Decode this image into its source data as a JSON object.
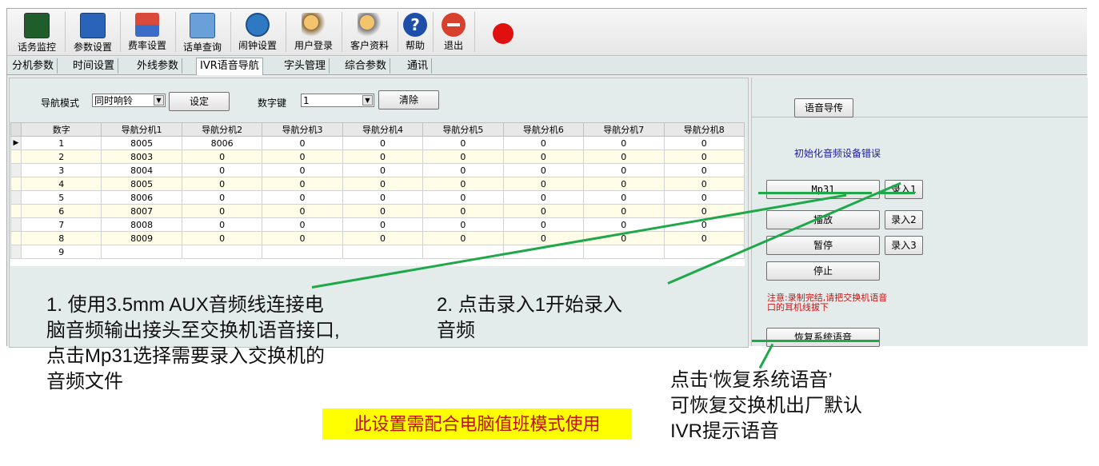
{
  "toolbar": {
    "items": [
      {
        "label": "话务监控",
        "icon": "monitor-icon"
      },
      {
        "label": "参数设置",
        "icon": "settings-screen-icon"
      },
      {
        "label": "费率设置",
        "icon": "rate-icon"
      },
      {
        "label": "话单查询",
        "icon": "search-screen-icon"
      },
      {
        "label": "闹钟设置",
        "icon": "clock-icon"
      },
      {
        "label": "用户登录",
        "icon": "users-key-icon"
      },
      {
        "label": "客户资料",
        "icon": "users-gear-icon"
      },
      {
        "label": "帮助",
        "icon": "help-icon"
      },
      {
        "label": "退出",
        "icon": "exit-icon"
      }
    ],
    "colors": {
      "record_dot": "#e01010"
    }
  },
  "tabs": [
    "分机参数",
    "时间设置",
    "外线参数",
    "IVR语音导航",
    "字头管理",
    "综合参数",
    "通讯"
  ],
  "active_tab": "IVR语音导航",
  "controls": {
    "nav_mode_label": "导航模式",
    "nav_mode_value": "同时响铃",
    "set_button": "设定",
    "digit_key_label": "数字键",
    "digit_key_value": "1",
    "clear_button": "清除"
  },
  "grid": {
    "columns": [
      "数字",
      "导航分机1",
      "导航分机2",
      "导航分机3",
      "导航分机4",
      "导航分机5",
      "导航分机6",
      "导航分机7",
      "导航分机8"
    ],
    "rows": [
      [
        "1",
        "8005",
        "8006",
        "0",
        "0",
        "0",
        "0",
        "0",
        "0"
      ],
      [
        "2",
        "8003",
        "0",
        "0",
        "0",
        "0",
        "0",
        "0",
        "0"
      ],
      [
        "3",
        "8004",
        "0",
        "0",
        "0",
        "0",
        "0",
        "0",
        "0"
      ],
      [
        "4",
        "8005",
        "0",
        "0",
        "0",
        "0",
        "0",
        "0",
        "0"
      ],
      [
        "5",
        "8006",
        "0",
        "0",
        "0",
        "0",
        "0",
        "0",
        "0"
      ],
      [
        "6",
        "8007",
        "0",
        "0",
        "0",
        "0",
        "0",
        "0",
        "0"
      ],
      [
        "7",
        "8008",
        "0",
        "0",
        "0",
        "0",
        "0",
        "0",
        "0"
      ],
      [
        "8",
        "8009",
        "0",
        "0",
        "0",
        "0",
        "0",
        "0",
        "0"
      ],
      [
        "9",
        "",
        "",
        "",
        "",
        "",
        "",
        "",
        ""
      ]
    ],
    "current_row_marker": "▶"
  },
  "right": {
    "upload_button": "语音导传",
    "status": "初始化音频设备错误",
    "mp3_button": "Mp31",
    "record1": "录入1",
    "record2": "录入2",
    "record3": "录入3",
    "play": "播放",
    "pause": "暂停",
    "stop": "停止",
    "note": "注意:录制完结,请把交换机语音口的耳机线拔下",
    "restore_button": "恢复系统语音"
  },
  "annotations": {
    "step1": [
      "1. 使用3.5mm AUX音频线连接电",
      "脑音频输出接头至交换机语音接口,",
      "点击Mp31选择需要录入交换机的",
      "音频文件"
    ],
    "step2": [
      "2. 点击录入1开始录入",
      "音频"
    ],
    "restore": [
      "点击‘恢复系统语音’",
      "可恢复交换机出厂默认",
      "IVR提示语音"
    ],
    "banner": "此设置需配合电脑值班模式使用",
    "line_color": "#1ea84a",
    "banner_color": "#ffff00"
  }
}
